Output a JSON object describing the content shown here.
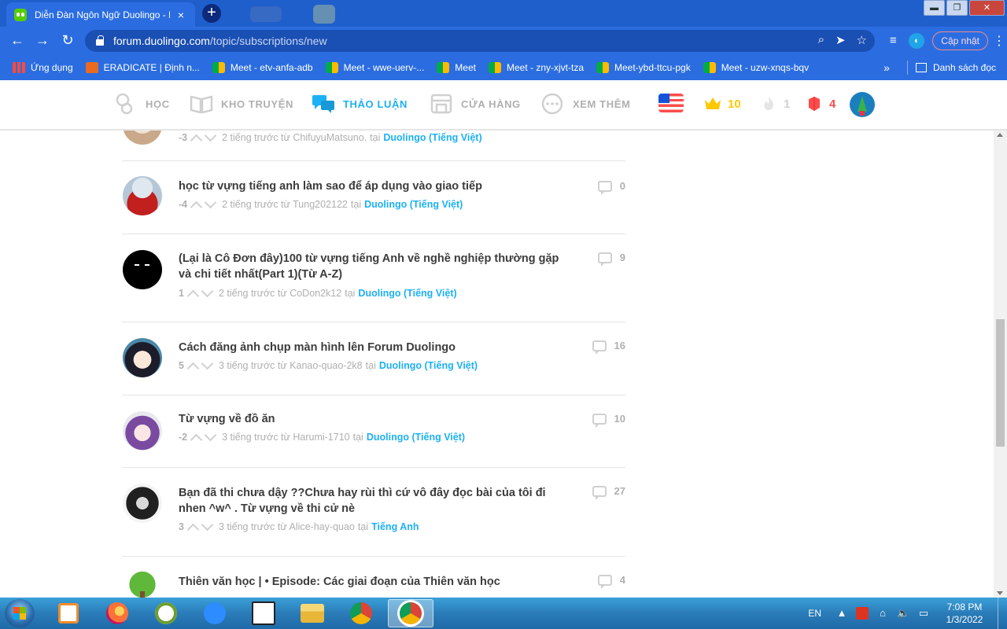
{
  "browser": {
    "tab_title": "Diễn Đàn Ngôn Ngữ Duolingo - D",
    "tab_close": "×",
    "new_tab": "+",
    "url_host": "forum.duolingo.com",
    "url_path": "/topic/subscriptions/new",
    "update_label": "Cập nhật",
    "window": {
      "minimize": "▬",
      "maximize": "❐",
      "close": "✕"
    }
  },
  "bookmarks": {
    "items": [
      {
        "label": "Ứng dụng",
        "icon": "apps-grid-icon"
      },
      {
        "label": "ERADICATE | Định n...",
        "icon": "eradicate-icon"
      },
      {
        "label": "Meet - etv-anfa-adb",
        "icon": "meet-icon"
      },
      {
        "label": "Meet - wwe-uerv-...",
        "icon": "meet-icon"
      },
      {
        "label": "Meet",
        "icon": "meet-icon"
      },
      {
        "label": "Meet - zny-xjvt-tza",
        "icon": "meet-icon"
      },
      {
        "label": "Meet-ybd-ttcu-pgk",
        "icon": "meet-icon"
      },
      {
        "label": "Meet - uzw-xnqs-bqv",
        "icon": "meet-icon"
      }
    ],
    "overflow": "»",
    "reading_list": "Danh sách đọc"
  },
  "duo_nav": {
    "items": [
      {
        "label": "HỌC",
        "icon": "learn-icon",
        "active": false
      },
      {
        "label": "KHO TRUYỆN",
        "icon": "book-icon",
        "active": false
      },
      {
        "label": "THẢO LUẬN",
        "icon": "chat-icon",
        "active": true
      },
      {
        "label": "CỬA HÀNG",
        "icon": "shop-icon",
        "active": false
      },
      {
        "label": "XEM THÊM",
        "icon": "more-icon",
        "active": false
      }
    ],
    "crowns": "10",
    "streak": "1",
    "gems": "4",
    "colors": {
      "active": "#1cb0f6",
      "crown": "#ffc800",
      "gem": "#ff4b4b"
    }
  },
  "topics": [
    {
      "title": "",
      "score": "-3",
      "time": "2 tiếng trước từ ChifuyuMatsuno.",
      "at": "tại",
      "forum": "Duolingo (Tiếng Việt)",
      "comments": ""
    },
    {
      "title": "học từ vựng tiếng anh làm sao để áp dụng vào giao tiếp",
      "score": "-4",
      "time": "2 tiếng trước từ Tung202122",
      "at": "tại",
      "forum": "Duolingo (Tiếng Việt)",
      "comments": "0"
    },
    {
      "title": "(Lại là Cô Đơn đây)100 từ vựng tiếng Anh về nghề nghiệp thường gặp và chi tiết nhất(Part 1)(Từ A-Z)",
      "score": "1",
      "time": "2 tiếng trước từ CoDon2k12",
      "at": "tại",
      "forum": "Duolingo (Tiếng Việt)",
      "comments": "9"
    },
    {
      "title": "Cách đăng ảnh chụp màn hình lên Forum Duolingo",
      "score": "5",
      "time": "3 tiếng trước từ Kanao-quao-2k8",
      "at": "tại",
      "forum": "Duolingo (Tiếng Việt)",
      "comments": "16"
    },
    {
      "title": "Từ vựng về đồ ăn",
      "score": "-2",
      "time": "3 tiếng trước từ Harumi-1710",
      "at": "tại",
      "forum": "Duolingo (Tiếng Việt)",
      "comments": "10"
    },
    {
      "title": "Bạn đã thi chưa dậy ??Chưa hay rùi thì cứ vô đây đọc bài của tôi đi nhen ^w^ . Từ vựng về thi cử nè",
      "score": "3",
      "time": "3 tiếng trước từ Alice-hay-quao",
      "at": "tại",
      "forum": "Tiếng Anh",
      "comments": "27"
    },
    {
      "title": "Thiên văn học | • Episode: Các giai đoạn của Thiên văn học",
      "score": "",
      "time": "",
      "at": "",
      "forum": "",
      "comments": "4"
    }
  ],
  "taskbar": {
    "lang": "EN",
    "time": "7:08 PM",
    "date": "1/3/2022",
    "apps": [
      "media-player-icon",
      "firefox-icon",
      "geogebra-icon",
      "zoom-icon",
      "pctex-icon",
      "file-explorer-icon",
      "chrome-icon",
      "chrome-active-icon"
    ]
  }
}
